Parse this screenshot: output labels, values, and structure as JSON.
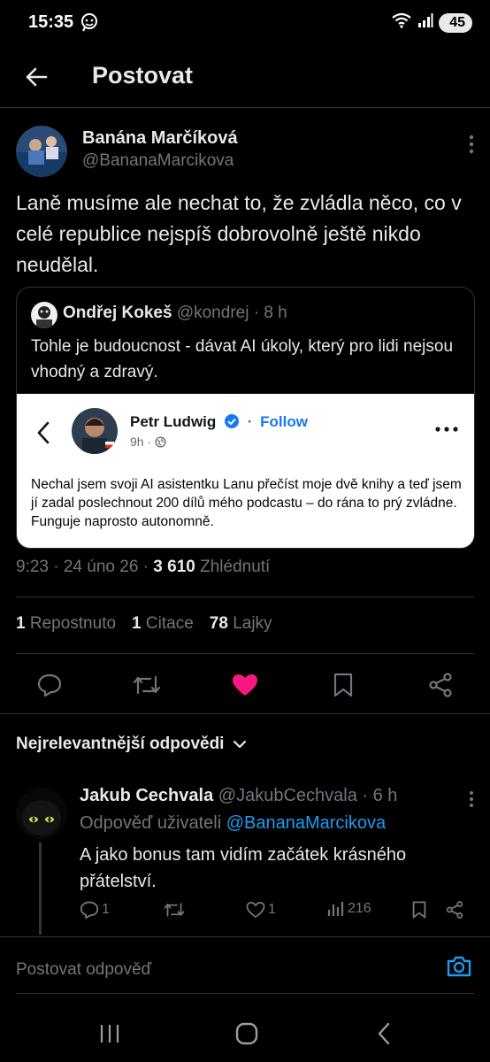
{
  "status_bar": {
    "time": "15:35",
    "battery": "45"
  },
  "header": {
    "title": "Postovat"
  },
  "post": {
    "author_name": "Banána Marčíková",
    "author_handle": "@BananaMarcikova",
    "text": "Laně musíme ale nechat to, že zvládla něco, co v celé republice nejspíš dobrovolně ještě nikdo neudělal.",
    "meta_time": "9:23 · 24 úno 26 · ",
    "meta_views": "3 610",
    "meta_views_label": " Zhlédnutí",
    "reposts_count": "1",
    "reposts_label": "Repostnuto",
    "quotes_count": "1",
    "quotes_label": "Citace",
    "likes_count": "78",
    "likes_label": "Lajky",
    "liked": true
  },
  "quote": {
    "author_name": "Ondřej Kokeš",
    "author_handle": "@kondrej",
    "time": " · 8 h",
    "text": "Tohle je budoucnost - dávat AI úkoly, který pro lidi nejsou vhodný a zdravý.",
    "embed": {
      "name": "Petr Ludwig",
      "follow": "Follow",
      "follow_separator": "·",
      "sub": "9h ·",
      "text": "Nechal jsem svoji AI asistentku Lanu přečíst moje dvě knihy a teď jsem jí zadal poslechnout 200 dílů mého podcastu – do rána to prý zvládne. Funguje naprosto autonomně."
    }
  },
  "sort": {
    "label": "Nejrelevantnější odpovědi"
  },
  "reply": {
    "author_name": "Jakub Cechvala",
    "author_handle": "@JakubCechvala",
    "time": " · 6 h",
    "reply_to_label": "Odpověď uživateli ",
    "reply_to_handle": "@BananaMarcikova",
    "text": "A jako bonus tam vidím začátek krásného přátelství.",
    "replies": "1",
    "likes": "1",
    "views": "216"
  },
  "compose": {
    "placeholder": "Postovat odpověď"
  },
  "colors": {
    "accent": "#1d9bf0",
    "like": "#f91880",
    "muted": "#71767b"
  }
}
